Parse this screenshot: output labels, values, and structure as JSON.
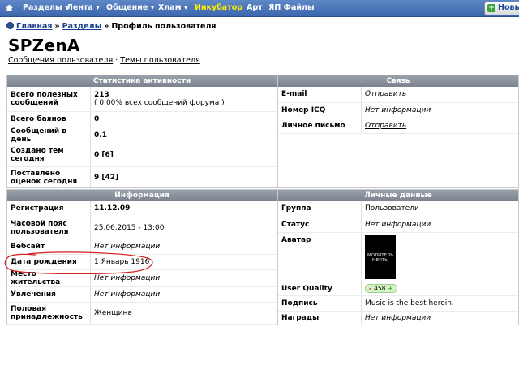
{
  "topbar": {
    "items": [
      {
        "label": "Разделы ▾"
      },
      {
        "label": "Лента ▾"
      },
      {
        "label": "Общение ▾"
      },
      {
        "label": "Хлам ▾"
      },
      {
        "label": "Инкубатор"
      },
      {
        "label": "Арт"
      },
      {
        "label": "ЯП Файлы"
      }
    ],
    "new_label": "Новы"
  },
  "breadcrumb": {
    "home": "Главная",
    "sep": "»",
    "sections": "Разделы",
    "current": "Профиль пользователя"
  },
  "user": {
    "name": "SPZenA",
    "link_posts": "Сообщения пользователя",
    "divider": "·",
    "link_topics": "Темы пользователя"
  },
  "stats": {
    "title": "Статистика активности",
    "rows": [
      {
        "label": "Всего полезных сообщений",
        "value": "213",
        "sub": "( 0.00% всех сообщений форума )"
      },
      {
        "label": "Всего баянов",
        "value": "0"
      },
      {
        "label": "Сообщений в день",
        "value": "0.1"
      },
      {
        "label": "Создано тем сегодня",
        "value": "0 [6]"
      },
      {
        "label": "Поставлено оценок сегодня",
        "value": "9 [42]"
      }
    ]
  },
  "contact": {
    "title": "Связь",
    "rows": [
      {
        "label": "E-mail",
        "value": "Отправить"
      },
      {
        "label": "Номер ICQ",
        "value": "Нет информации"
      },
      {
        "label": "Личное письмо",
        "value": "Отправить"
      }
    ]
  },
  "info": {
    "title": "Информация",
    "rows": [
      {
        "label": "Регистрация",
        "value": "11.12.09"
      },
      {
        "label": "Часовой пояс пользователя",
        "value": "25.06.2015 - 13:00"
      },
      {
        "label": "Вебсайт",
        "value": "Нет информации"
      },
      {
        "label": "Дата рождения",
        "value": "1 Январь 1916"
      },
      {
        "label": "Место жительства",
        "value": "Нет информации"
      },
      {
        "label": "Увлечения",
        "value": "Нет информации"
      },
      {
        "label": "Половая принадлежность",
        "value": "Женщина"
      }
    ]
  },
  "personal": {
    "title": "Личные данные",
    "rows": [
      {
        "label": "Группа",
        "value": "Пользователи"
      },
      {
        "label": "Статус",
        "value": "Нет информации"
      },
      {
        "label": "Аватар",
        "value": "МОЛИТЕЛЬ МЕЧТЫ"
      },
      {
        "label": "User Quality",
        "minus": "-",
        "value": "458",
        "plus": "+"
      },
      {
        "label": "Подпись",
        "value": "Music is the best heroin."
      },
      {
        "label": "Награды",
        "value": "Нет информации"
      }
    ]
  },
  "colors": {
    "accent": "#ffee00",
    "nav_bar": "#4a74b8",
    "panel_header": "#8a919b",
    "annotation": "#d02020"
  }
}
